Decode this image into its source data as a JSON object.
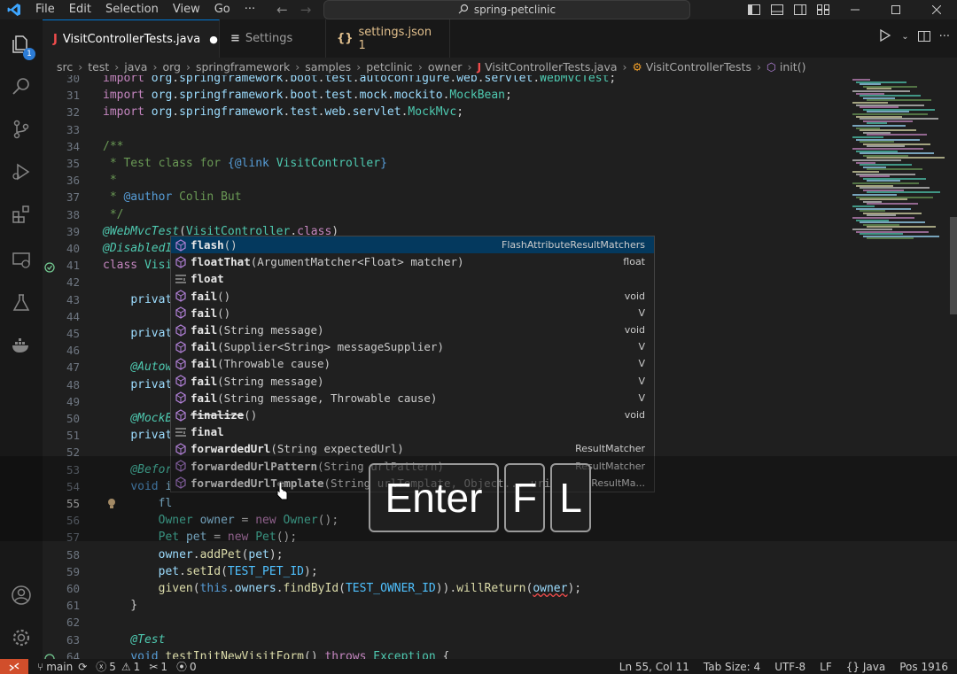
{
  "titlebar": {
    "menu": [
      "File",
      "Edit",
      "Selection",
      "View",
      "Go"
    ],
    "more": "···",
    "search": "spring-petclinic"
  },
  "activity_bar": {
    "explorer_badge": "1"
  },
  "tabs": [
    {
      "icon": "J",
      "label": "VisitControllerTests.java",
      "modified": "●",
      "active": true
    },
    {
      "icon": "≡",
      "label": "Settings",
      "active": false
    },
    {
      "icon": "{}",
      "label": "settings.json 1",
      "active": false
    }
  ],
  "breadcrumb": [
    "src",
    "test",
    "java",
    "org",
    "springframework",
    "samples",
    "petclinic",
    "owner",
    "VisitControllerTests.java",
    "VisitControllerTests",
    "init()"
  ],
  "line_numbers": [
    "30",
    "31",
    "32",
    "33",
    "34",
    "35",
    "36",
    "37",
    "38",
    "39",
    "40",
    "41",
    "42",
    "43",
    "44",
    "45",
    "46",
    "47",
    "48",
    "49",
    "50",
    "51",
    "52",
    "53",
    "54",
    "55",
    "56",
    "57",
    "58",
    "59",
    "60",
    "61",
    "62",
    "63",
    "64"
  ],
  "code": [
    "import org.springframework.boot.test.autoconfigure.web.servlet.WebMvcTest;",
    "import org.springframework.boot.test.mock.mockito.MockBean;",
    "import org.springframework.test.web.servlet.MockMvc;",
    "",
    "/**",
    " * Test class for {@link VisitController}",
    " *",
    " * @author Colin But",
    " */",
    "@WebMvcTest(VisitController.class)",
    "@DisabledI",
    "class Visi",
    "",
    "    privat",
    "",
    "    privat",
    "",
    "    @Autow",
    "    privat",
    "",
    "    @MockB",
    "    privat",
    "",
    "    @Befor",
    "    void i",
    "        fl",
    "        Owner owner = new Owner();",
    "        Pet pet = new Pet();",
    "        owner.addPet(pet);",
    "        pet.setId(TEST_PET_ID);",
    "        given(this.owners.findById(TEST_OWNER_ID)).willReturn(owner);",
    "    }",
    "",
    "    @Test",
    "    void testInitNewVisitForm() throws Exception {"
  ],
  "suggestions": [
    {
      "icon": "method",
      "name": "flash",
      "sig": "()",
      "detail": "FlashAttributeResultMatchers"
    },
    {
      "icon": "method",
      "name": "floatThat",
      "sig": "(ArgumentMatcher<Float> matcher)",
      "detail": "float"
    },
    {
      "icon": "keyword",
      "name": "float",
      "sig": "",
      "detail": ""
    },
    {
      "icon": "method",
      "name": "fail",
      "sig": "()",
      "detail": "void"
    },
    {
      "icon": "method",
      "name": "fail",
      "sig": "()",
      "detail": "V"
    },
    {
      "icon": "method",
      "name": "fail",
      "sig": "(String message)",
      "detail": "void"
    },
    {
      "icon": "method",
      "name": "fail",
      "sig": "(Supplier<String> messageSupplier)",
      "detail": "V"
    },
    {
      "icon": "method",
      "name": "fail",
      "sig": "(Throwable cause)",
      "detail": "V"
    },
    {
      "icon": "method",
      "name": "fail",
      "sig": "(String message)",
      "detail": "V"
    },
    {
      "icon": "method",
      "name": "fail",
      "sig": "(String message, Throwable cause)",
      "detail": "V"
    },
    {
      "icon": "method",
      "name": "finalize",
      "sig": "()",
      "detail": "void",
      "deprecated": true
    },
    {
      "icon": "keyword",
      "name": "final",
      "sig": "",
      "detail": ""
    },
    {
      "icon": "method",
      "name": "forwardedUrl",
      "sig": "(String expectedUrl)",
      "detail": "ResultMatcher"
    },
    {
      "icon": "method",
      "name": "forwardedUrlPattern",
      "sig": "(String urlPattern)",
      "detail": "ResultMatcher"
    },
    {
      "icon": "method",
      "name": "forwardedUrlTemplate",
      "sig": "(String urlTemplate, Object... uri",
      "detail": "ResultMa..."
    }
  ],
  "keys": [
    "Enter",
    "F",
    "L"
  ],
  "statusbar": {
    "branch": "main",
    "errors": "5",
    "warnings": "1",
    "ports": "1",
    "ai": "0",
    "position": "Ln 55, Col 11",
    "tab_size": "Tab Size: 4",
    "encoding": "UTF-8",
    "eol": "LF",
    "language": "Java",
    "pos": "Pos 1916"
  },
  "colors": {
    "accent": "#0078d4",
    "remote": "#d14e2b",
    "selection": "#04395e"
  }
}
